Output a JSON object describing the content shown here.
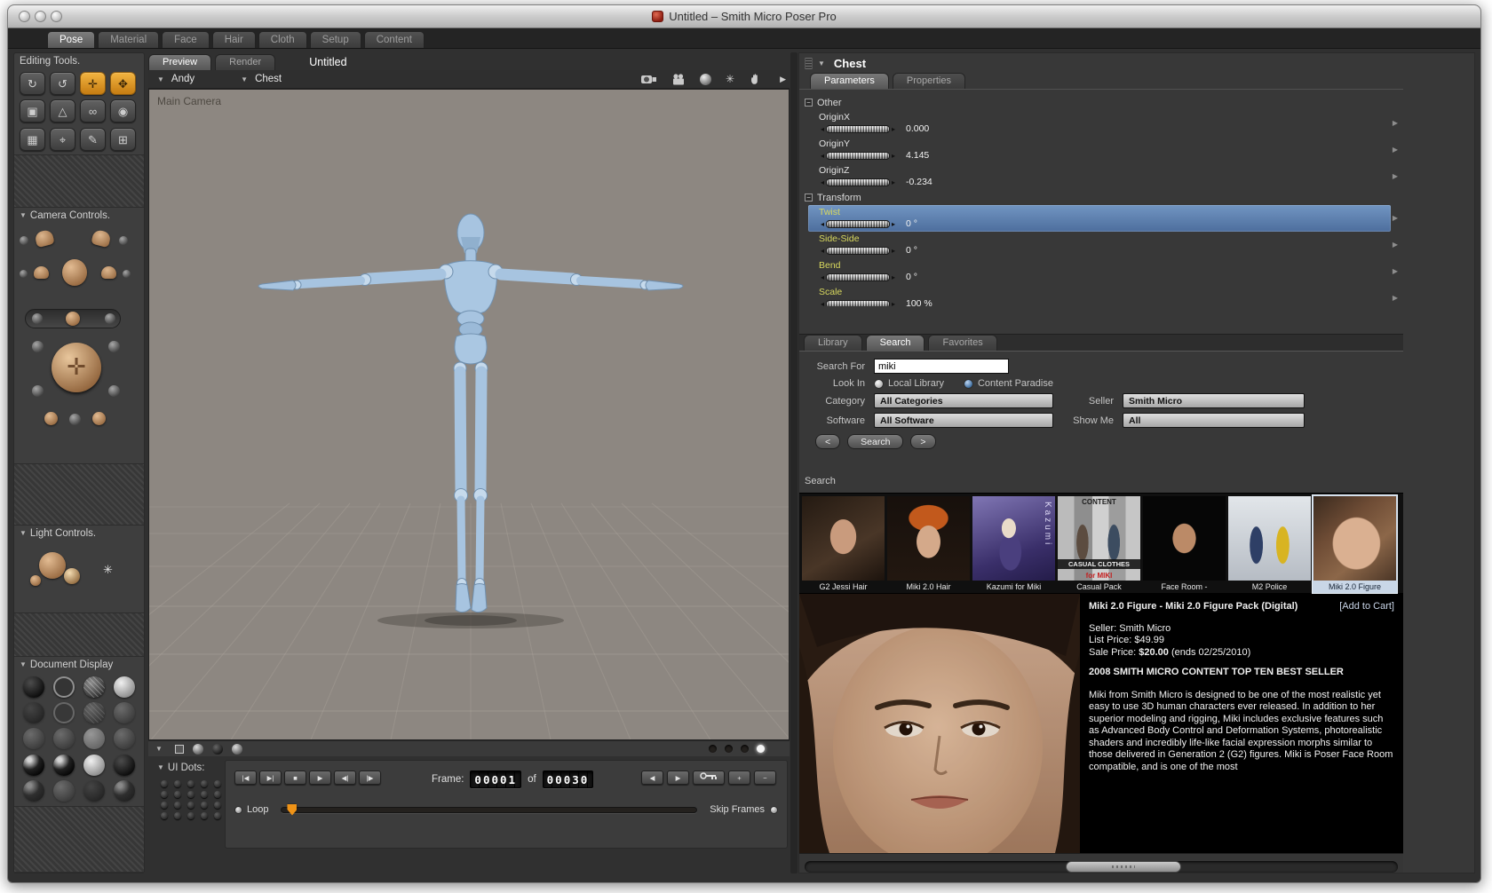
{
  "window": {
    "title": "Untitled – Smith Micro Poser Pro"
  },
  "main_tabs": [
    {
      "label": "Pose",
      "active": true
    },
    {
      "label": "Material",
      "active": false
    },
    {
      "label": "Face",
      "active": false
    },
    {
      "label": "Hair",
      "active": false
    },
    {
      "label": "Cloth",
      "active": false
    },
    {
      "label": "Setup",
      "active": false
    },
    {
      "label": "Content",
      "active": false
    }
  ],
  "left_panel": {
    "editing_tools_label": "Editing Tools.",
    "camera_controls_label": "Camera Controls.",
    "light_controls_label": "Light Controls.",
    "document_display_label": "Document Display",
    "tools": [
      {
        "name": "rotate-tool",
        "glyph": "↻",
        "active": false
      },
      {
        "name": "twist-tool",
        "glyph": "↺",
        "active": false
      },
      {
        "name": "translate-pull-tool",
        "glyph": "✛",
        "active": true
      },
      {
        "name": "translate-in-out-tool",
        "glyph": "✥",
        "active": true
      },
      {
        "name": "scale-tool",
        "glyph": "▣",
        "active": false
      },
      {
        "name": "taper-tool",
        "glyph": "△",
        "active": false
      },
      {
        "name": "chain-break-tool",
        "glyph": "∞",
        "active": false
      },
      {
        "name": "color-tool",
        "glyph": "◉",
        "active": false
      },
      {
        "name": "grouping-tool",
        "glyph": "▦",
        "active": false
      },
      {
        "name": "view-magnifier-tool",
        "glyph": "⌖",
        "active": false
      },
      {
        "name": "morphing-tool",
        "glyph": "✎",
        "active": false
      },
      {
        "name": "direct-manipulation-tool",
        "glyph": "⊞",
        "active": false
      }
    ]
  },
  "viewport": {
    "tabs": [
      {
        "label": "Preview",
        "active": true
      },
      {
        "label": "Render",
        "active": false
      }
    ],
    "document_title": "Untitled",
    "figure_menu": "Andy",
    "actor_menu": "Chest",
    "camera_label": "Main Camera",
    "menu_arrow": "▼",
    "scroll_arrow": "▶"
  },
  "animation": {
    "ui_dots_label": "UI Dots:",
    "frame_label": "Frame:",
    "current_frame": "00001",
    "of_label": "of",
    "total_frames": "00030",
    "loop_label": "Loop",
    "skip_frames_label": "Skip Frames",
    "transport": [
      "|◀",
      "▶|",
      "■",
      "▶",
      "◀|",
      "|▶"
    ],
    "nudge_back": "◀",
    "nudge_forward": "▶",
    "add_key_label": "+",
    "delete_key_label": "−"
  },
  "parameters": {
    "title": "Chest",
    "collapse_glyph": "−",
    "row_arrow": "▶",
    "tabs": [
      {
        "label": "Parameters",
        "active": true
      },
      {
        "label": "Properties",
        "active": false
      }
    ],
    "groups": [
      {
        "name": "Other",
        "params": [
          {
            "label": "OriginX",
            "value": "0.000"
          },
          {
            "label": "OriginY",
            "value": "4.145"
          },
          {
            "label": "OriginZ",
            "value": "-0.234"
          }
        ]
      },
      {
        "name": "Transform",
        "params": [
          {
            "label": "Twist",
            "value": "0 °",
            "highlighted": true
          },
          {
            "label": "Side-Side",
            "value": "0 °"
          },
          {
            "label": "Bend",
            "value": "0 °"
          },
          {
            "label": "Scale",
            "value": "100 %"
          }
        ]
      }
    ]
  },
  "library": {
    "tabs": [
      {
        "label": "Library",
        "active": false
      },
      {
        "label": "Search",
        "active": true
      },
      {
        "label": "Favorites",
        "active": false
      }
    ],
    "search_for_label": "Search For",
    "search_value": "miki",
    "look_in_label": "Look In",
    "look_in_options": [
      {
        "label": "Local Library",
        "selected": false
      },
      {
        "label": "Content Paradise",
        "selected": true
      }
    ],
    "category_label": "Category",
    "category_value": "All Categories",
    "seller_label": "Seller",
    "seller_value": "Smith Micro",
    "software_label": "Software",
    "software_value": "All Software",
    "show_me_label": "Show Me",
    "show_me_value": "All",
    "prev_label": "<",
    "search_button_label": "Search",
    "next_label": ">",
    "results_section_label": "Search",
    "results": [
      {
        "caption": "G2 Jessi Hair",
        "selected": false
      },
      {
        "caption": "Miki 2.0 Hair",
        "selected": false
      },
      {
        "caption": "Kazumi for Miki",
        "selected": false,
        "overlay": "Kazumi"
      },
      {
        "caption": "Casual Pack",
        "selected": false,
        "overlay_top": "CONTENT",
        "overlay_mid": "CASUAL CLOTHES",
        "overlay_bottom": "for MIKI"
      },
      {
        "caption": "Face Room -",
        "selected": false
      },
      {
        "caption": "M2 Police",
        "selected": false
      },
      {
        "caption": "Miki 2.0 Figure",
        "selected": true
      }
    ]
  },
  "product": {
    "title": "Miki 2.0 Figure - Miki 2.0 Figure Pack (Digital)",
    "add_to_cart_label": "[Add to Cart]",
    "seller_line": "Seller: Smith Micro",
    "list_price_line": "List Price: $49.99",
    "sale_price_label": "Sale Price: ",
    "sale_price_value": "$20.00",
    "sale_price_suffix": " (ends 02/25/2010)",
    "badge": "2008 SMITH MICRO CONTENT TOP TEN BEST SELLER",
    "description": "Miki from Smith Micro is designed to be one of the most realistic yet easy to use 3D human characters ever released. In addition to her superior modeling and rigging, Miki includes exclusive features such as Advanced Body Control and Deformation Systems, photorealistic shaders and incredibly life-like facial expression morphs similar to those delivered in Generation 2 (G2) figures. Miki is Poser Face Room compatible, and is one of the most"
  },
  "colors": {
    "selection_highlight": "#5a7fae",
    "param_label_yellow": "#d8d85e",
    "keyframe_orange": "#ef9317",
    "tool_active_orange": "#e8a227"
  }
}
